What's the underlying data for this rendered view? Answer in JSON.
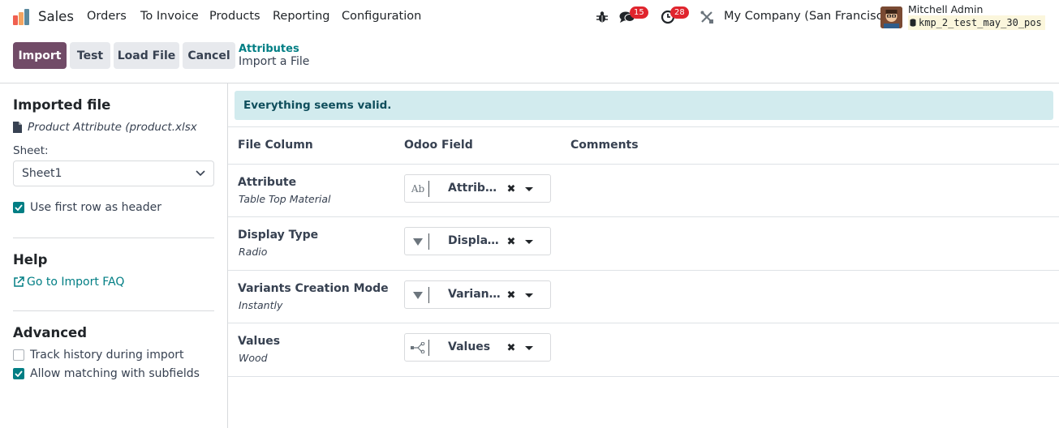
{
  "navbar": {
    "app_name": "Sales",
    "menu": [
      "Orders",
      "To Invoice",
      "Products",
      "Reporting",
      "Configuration"
    ],
    "messages_count": "15",
    "activities_count": "28",
    "company": "My Company (San Francisco)",
    "user_name": "Mitchell Admin",
    "database": "kmp_2_test_may_30_pos"
  },
  "toolbar": {
    "import_label": "Import",
    "test_label": "Test",
    "load_file_label": "Load File",
    "cancel_label": "Cancel"
  },
  "breadcrumb": {
    "parent": "Attributes",
    "current": "Import a File"
  },
  "sidebar": {
    "imported_file_title": "Imported file",
    "file_name": "Product Attribute (product.xlsx",
    "sheet_label": "Sheet:",
    "sheet_value": "Sheet1",
    "first_row_header_label": "Use first row as header",
    "first_row_header_checked": true,
    "help_title": "Help",
    "faq_link": "Go to Import FAQ",
    "advanced_title": "Advanced",
    "track_history_label": "Track history during import",
    "track_history_checked": false,
    "allow_matching_label": "Allow matching with subfields",
    "allow_matching_checked": true
  },
  "main": {
    "alert": "Everything seems valid.",
    "headers": {
      "file_column": "File Column",
      "odoo_field": "Odoo Field",
      "comments": "Comments"
    },
    "rows": [
      {
        "column": "Attribute",
        "sample": "Table Top Material",
        "field": "Attribute",
        "field_icon": "text-field-icon"
      },
      {
        "column": "Display Type",
        "sample": "Radio",
        "field": "Display Type",
        "field_icon": "selection-field-icon"
      },
      {
        "column": "Variants Creation Mode",
        "sample": "Instantly",
        "field": "Variants Creation Mode",
        "field_icon": "selection-field-icon"
      },
      {
        "column": "Values",
        "sample": "Wood",
        "field": "Values",
        "field_icon": "relation-field-icon"
      }
    ]
  },
  "colors": {
    "primary": "#714b67",
    "link": "#017e84",
    "badge": "#e0242d",
    "alert_bg": "#d2ebee",
    "alert_text": "#0f4e5c"
  }
}
